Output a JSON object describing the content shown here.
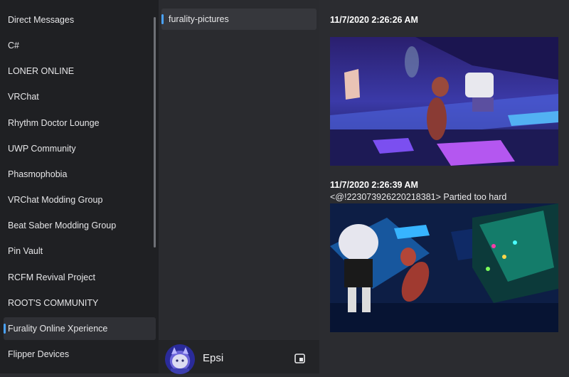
{
  "servers": {
    "items": [
      {
        "label": "Direct Messages"
      },
      {
        "label": "C#"
      },
      {
        "label": "LONER ONLINE"
      },
      {
        "label": "VRChat"
      },
      {
        "label": "Rhythm Doctor Lounge"
      },
      {
        "label": "UWP Community"
      },
      {
        "label": "Phasmophobia"
      },
      {
        "label": "VRChat Modding Group"
      },
      {
        "label": "Beat Saber Modding Group"
      },
      {
        "label": "Pin Vault"
      },
      {
        "label": "RCFM Revival Project"
      },
      {
        "label": "ROOT'S COMMUNITY"
      },
      {
        "label": "Furality Online Xperience"
      },
      {
        "label": "Flipper Devices"
      }
    ],
    "selected_index": 12
  },
  "channels": {
    "items": [
      {
        "label": "furality-pictures"
      }
    ]
  },
  "user": {
    "name": "Epsi",
    "settings_icon": "settings-icon"
  },
  "messages": [
    {
      "timestamp": "11/7/2020 2:26:26 AM",
      "text": "",
      "image": "club-dance-floor-screenshot"
    },
    {
      "timestamp": "11/7/2020 2:26:39 AM",
      "text": "<@!223073926220218381> Partied too hard",
      "image": "avatars-falling-screenshot"
    }
  ],
  "colors": {
    "accent": "#4aa3ff",
    "sidebar_bg": "#1f2023",
    "channel_bg": "#2a2b2f",
    "content_bg": "#2b2c30"
  }
}
